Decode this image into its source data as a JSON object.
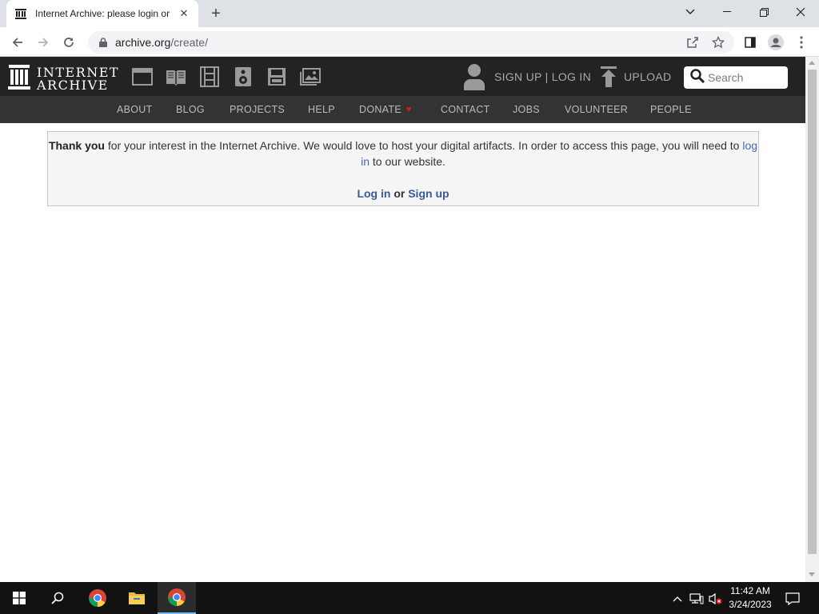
{
  "browser": {
    "tab_title": "Internet Archive: please login or sign up",
    "url_host": "archive.org",
    "url_path": "/create/"
  },
  "ia": {
    "logo_line1": "INTERNET",
    "logo_line2": "ARCHIVE",
    "signup_label": "SIGN UP | LOG IN",
    "upload_label": "UPLOAD",
    "search_placeholder": "Search",
    "nav": [
      "ABOUT",
      "BLOG",
      "PROJECTS",
      "HELP",
      "DONATE",
      "CONTACT",
      "JOBS",
      "VOLUNTEER",
      "PEOPLE"
    ],
    "heart_color": "#d81b1b"
  },
  "notice": {
    "bold_lead": "Thank you",
    "text_1": " for your interest in the Internet Archive. We would love to host your digital artifacts. In order to access this page, you will need to ",
    "login_link": "log in",
    "text_2": " to our website.",
    "action_login": "Log in",
    "action_or": " or ",
    "action_signup": "Sign up"
  },
  "taskbar": {
    "time": "11:42 AM",
    "date": "3/24/2023"
  }
}
